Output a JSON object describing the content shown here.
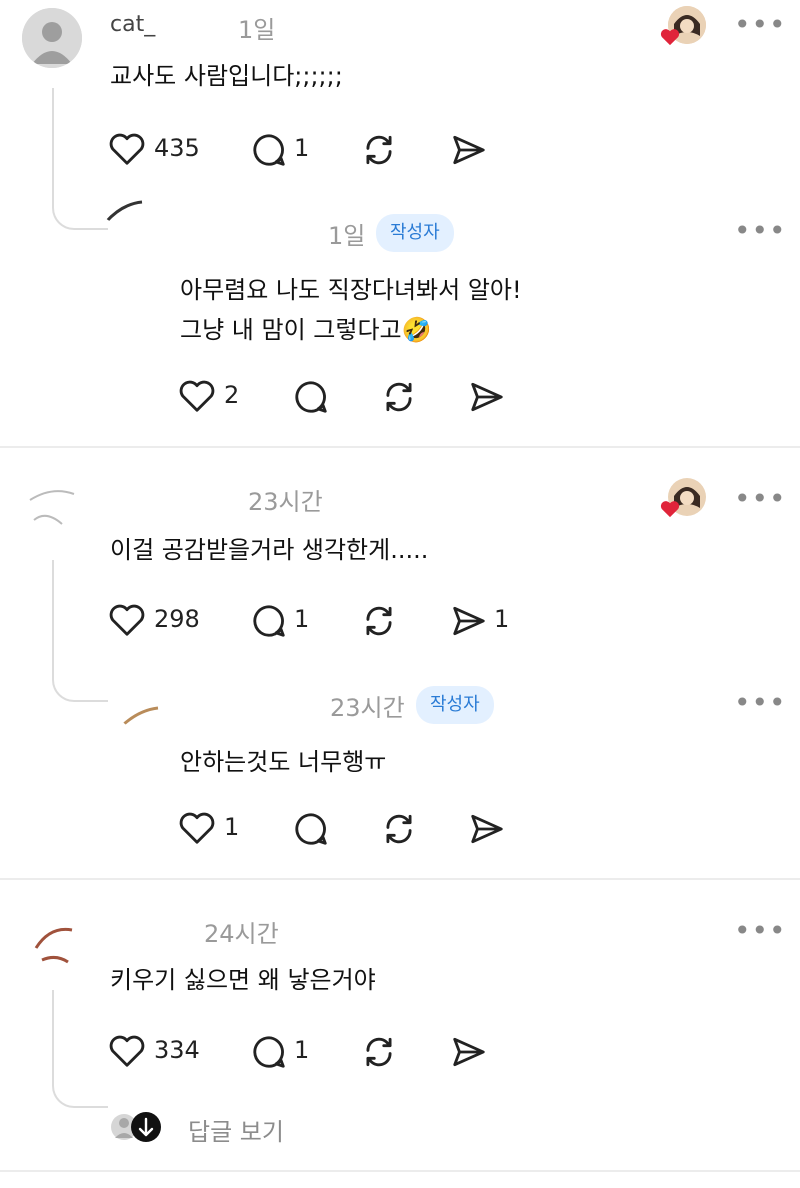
{
  "comments": [
    {
      "username": "cat_",
      "time": "1일",
      "text": "교사도 사람입니다;;;;;;",
      "likes": "435",
      "replies": "1",
      "reply": {
        "username": "",
        "time": "1일",
        "badge": "작성자",
        "lines": [
          "아무렴요 나도 직장다녀봐서 알아!",
          "그냥 내 맘이 그렇다고🤣"
        ],
        "likes": "2"
      }
    },
    {
      "username": "",
      "time": "23시간",
      "text": "이걸 공감받을거라 생각한게.....",
      "likes": "298",
      "replies": "1",
      "shares": "1",
      "reply": {
        "username": "",
        "time": "23시간",
        "badge": "작성자",
        "lines": [
          "안하는것도 너무행ㅠ"
        ],
        "likes": "1"
      }
    },
    {
      "username": "",
      "time": "24시간",
      "text": "키우기 싫으면 왜 낳은거야",
      "likes": "334",
      "replies": "1",
      "view_replies": "답글 보기"
    }
  ],
  "more_symbol": "•••",
  "colors": {
    "heart_red": "#e0243a",
    "badge_bg": "#e3f0ff",
    "badge_text": "#2a7bd5"
  }
}
